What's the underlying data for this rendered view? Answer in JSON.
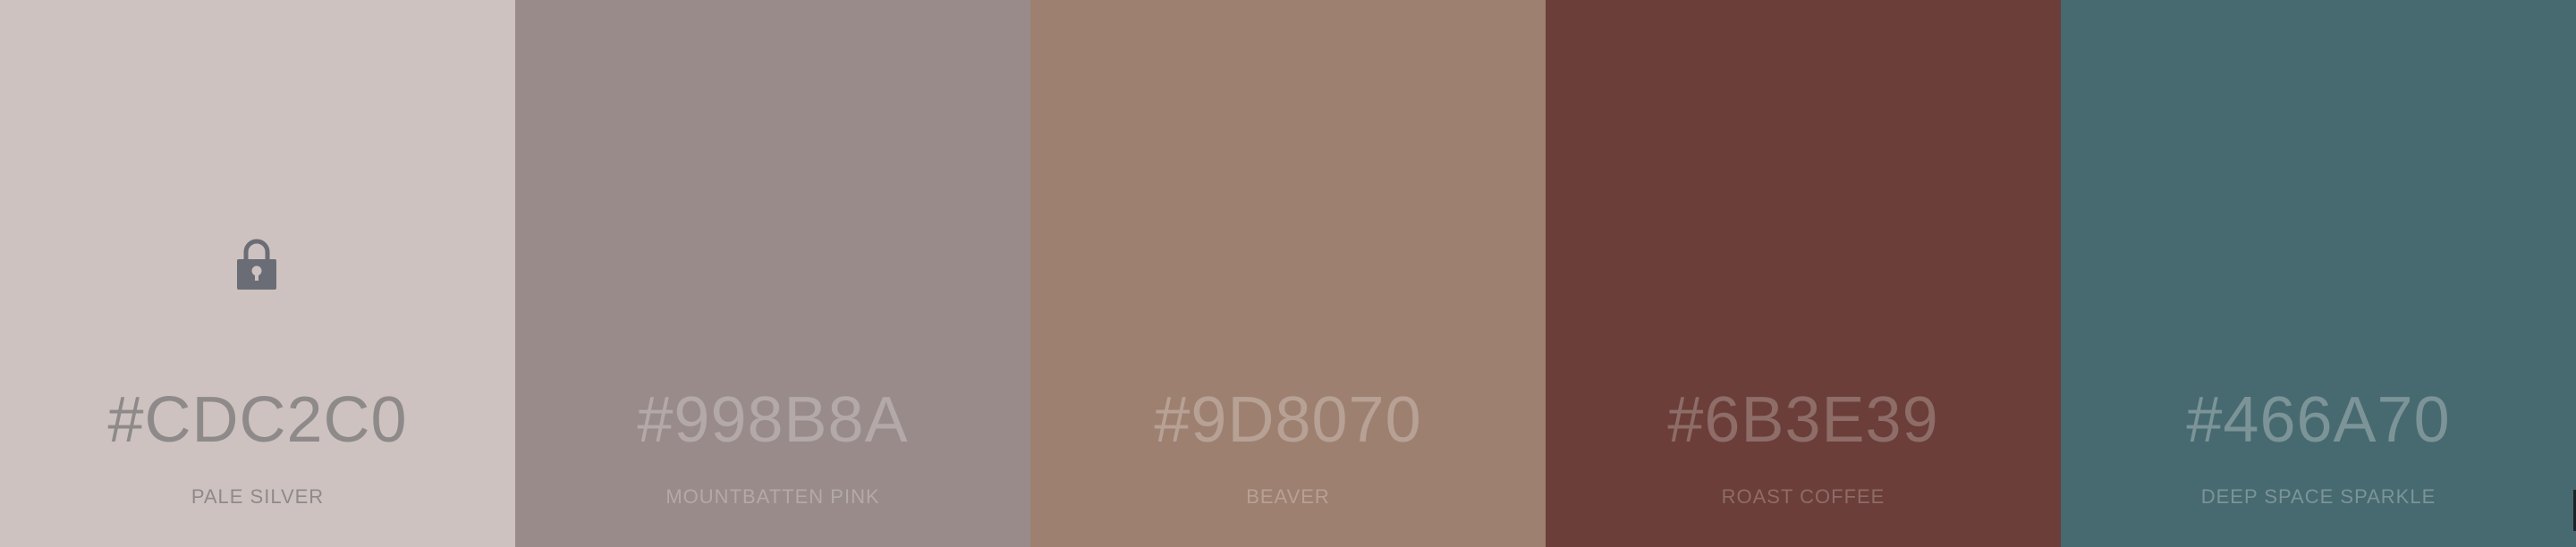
{
  "palette": {
    "colors": [
      {
        "hex": "#CDC2C0",
        "name": "PALE SILVER",
        "background": "#CDC2C0",
        "text_color": "#8E8A8A",
        "locked": true,
        "lock_icon": "padlock-icon",
        "lock_color": "#6A6D75"
      },
      {
        "hex": "#998B8A",
        "name": "MOUNTBATTEN PINK",
        "background": "#998B8A",
        "text_color": "#B3A9A8",
        "locked": false
      },
      {
        "hex": "#9D8070",
        "name": "BEAVER",
        "background": "#9D8070",
        "text_color": "#B7A194",
        "locked": false
      },
      {
        "hex": "#6B3E39",
        "name": "ROAST COFFEE",
        "background": "#6B3E39",
        "text_color": "#8E6C68",
        "locked": false
      },
      {
        "hex": "#466A70",
        "name": "DEEP SPACE SPARKLE",
        "background": "#466A70",
        "text_color": "#7C9498",
        "locked": false
      }
    ]
  }
}
